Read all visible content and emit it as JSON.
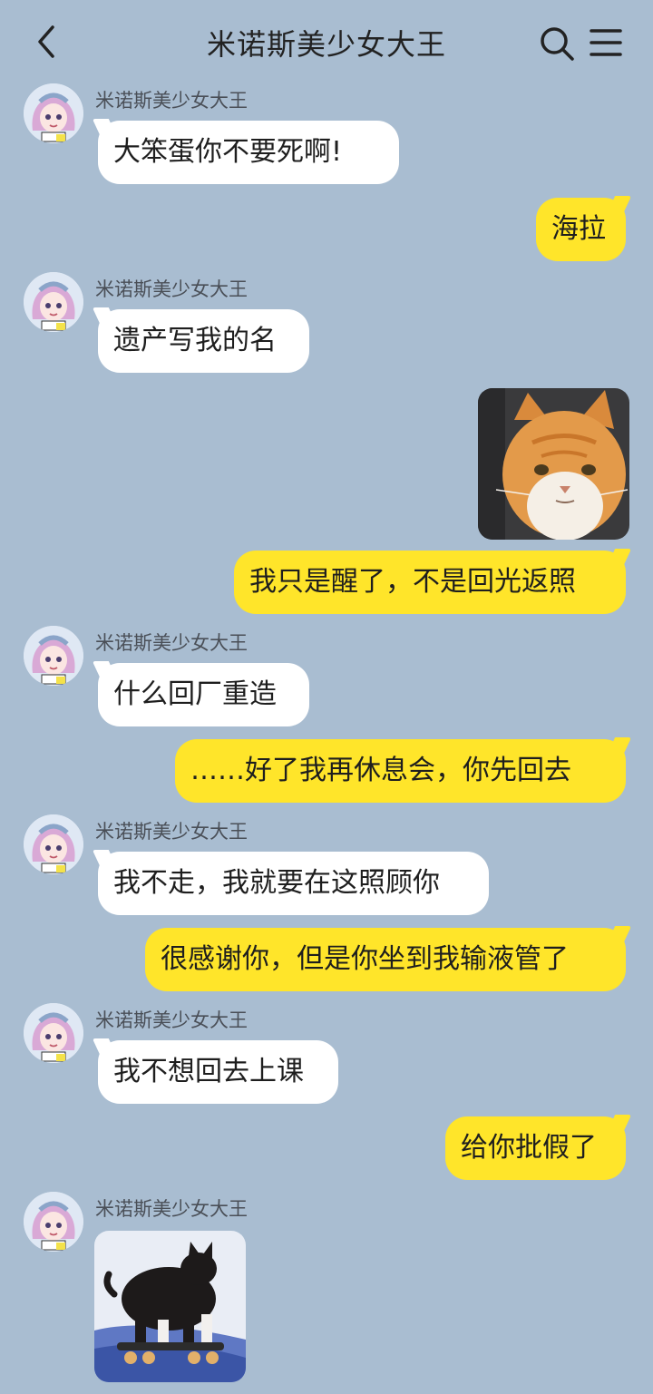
{
  "header": {
    "title": "米诺斯美少女大王",
    "back_icon": "chevron-left-icon",
    "search_icon": "search-icon",
    "menu_icon": "menu-icon"
  },
  "colors": {
    "background": "#a9bdd1",
    "incoming_bubble": "#ffffff",
    "outgoing_bubble": "#ffe52a"
  },
  "messages": [
    {
      "side": "incoming",
      "sender": "米诺斯美少女大王",
      "type": "text",
      "text": "大笨蛋你不要死啊!"
    },
    {
      "side": "outgoing",
      "type": "text",
      "text": "海拉"
    },
    {
      "side": "incoming",
      "sender": "米诺斯美少女大王",
      "type": "text",
      "text": "遗产写我的名"
    },
    {
      "side": "outgoing",
      "type": "image",
      "image": "orange-cat-sticker"
    },
    {
      "side": "outgoing",
      "type": "text",
      "text": "我只是醒了，不是回光返照"
    },
    {
      "side": "incoming",
      "sender": "米诺斯美少女大王",
      "type": "text",
      "text": "什么回厂重造"
    },
    {
      "side": "outgoing",
      "type": "text",
      "text": "……好了我再休息会，你先回去"
    },
    {
      "side": "incoming",
      "sender": "米诺斯美少女大王",
      "type": "text",
      "text": "我不走，我就要在这照顾你"
    },
    {
      "side": "outgoing",
      "type": "text",
      "text": "很感谢你，但是你坐到我输液管了"
    },
    {
      "side": "incoming",
      "sender": "米诺斯美少女大王",
      "type": "text",
      "text": "我不想回去上课"
    },
    {
      "side": "outgoing",
      "type": "text",
      "text": "给你批假了"
    },
    {
      "side": "incoming",
      "sender": "米诺斯美少女大王",
      "type": "image",
      "image": "skateboard-cat-sticker"
    }
  ]
}
